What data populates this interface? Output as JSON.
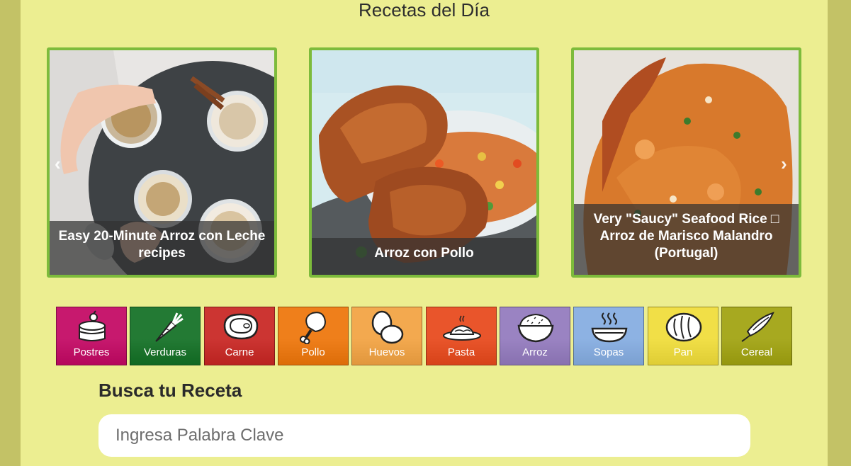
{
  "section": {
    "title": "Recetas del Día"
  },
  "carousel": {
    "prev_icon": "chevron-left-icon",
    "next_icon": "chevron-right-icon",
    "cards": [
      {
        "caption": "Easy 20-Minute Arroz con Leche recipes"
      },
      {
        "caption": "Arroz con Pollo"
      },
      {
        "caption": "Very \"Saucy\" Seafood Rice □ Arroz de Marisco Malandro (Portugal)"
      }
    ]
  },
  "categories": [
    {
      "label": "Postres",
      "icon": "cake-icon",
      "color": "#c7196e"
    },
    {
      "label": "Verduras",
      "icon": "carrot-icon",
      "color": "#237a34"
    },
    {
      "label": "Carne",
      "icon": "steak-icon",
      "color": "#cc3532"
    },
    {
      "label": "Pollo",
      "icon": "drumstick-icon",
      "color": "#ef7f1b"
    },
    {
      "label": "Huevos",
      "icon": "eggs-icon",
      "color": "#f3a94f"
    },
    {
      "label": "Pasta",
      "icon": "pasta-dish-icon",
      "color": "#e9552b"
    },
    {
      "label": "Arroz",
      "icon": "rice-bowl-icon",
      "color": "#9a83c2"
    },
    {
      "label": "Sopas",
      "icon": "soup-bowl-icon",
      "color": "#8db2e3"
    },
    {
      "label": "Pan",
      "icon": "bread-icon",
      "color": "#f1df47"
    },
    {
      "label": "Cereal",
      "icon": "grain-icon",
      "color": "#a7a920"
    }
  ],
  "search": {
    "heading": "Busca tu Receta",
    "placeholder": "Ingresa Palabra Clave"
  }
}
